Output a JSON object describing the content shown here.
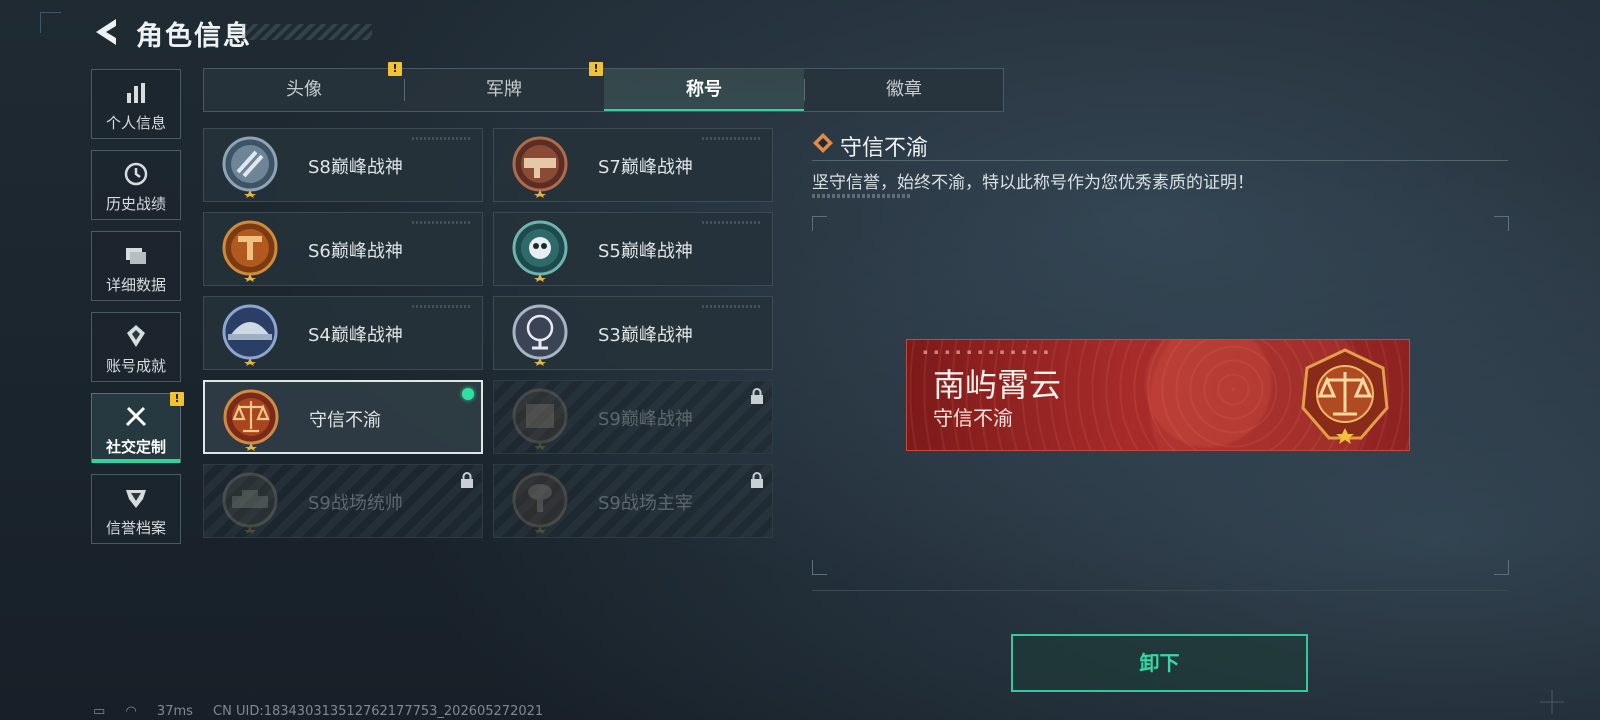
{
  "header": {
    "title": "角色信息"
  },
  "sidebar": {
    "items": [
      {
        "label": "个人信息",
        "icon": "bar-chart-icon"
      },
      {
        "label": "历史战绩",
        "icon": "clock-icon"
      },
      {
        "label": "详细数据",
        "icon": "folder-icon"
      },
      {
        "label": "账号成就",
        "icon": "achievement-icon"
      },
      {
        "label": "社交定制",
        "icon": "tools-icon",
        "active": true,
        "badge": "!"
      },
      {
        "label": "信誉档案",
        "icon": "credit-icon"
      }
    ]
  },
  "tabs": [
    {
      "label": "头像",
      "badge": "!"
    },
    {
      "label": "军牌",
      "badge": "!"
    },
    {
      "label": "称号",
      "active": true
    },
    {
      "label": "徽章"
    }
  ],
  "titles": [
    {
      "name": "S8巅峰战神",
      "icon": "s8-medal-icon"
    },
    {
      "name": "S7巅峰战神",
      "icon": "s7-medal-icon"
    },
    {
      "name": "S6巅峰战神",
      "icon": "s6-medal-icon"
    },
    {
      "name": "S5巅峰战神",
      "icon": "s5-medal-icon"
    },
    {
      "name": "S4巅峰战神",
      "icon": "s4-medal-icon"
    },
    {
      "name": "S3巅峰战神",
      "icon": "s3-medal-icon"
    },
    {
      "name": "守信不渝",
      "icon": "scales-medal-icon",
      "selected": true,
      "equipped": true
    },
    {
      "name": "S9巅峰战神",
      "icon": "s9-medal-icon",
      "locked": true
    },
    {
      "name": "S9战场统帅",
      "icon": "s9-commander-icon",
      "locked": true
    },
    {
      "name": "S9战场主宰",
      "icon": "s9-dominator-icon",
      "locked": true
    }
  ],
  "detail": {
    "title": "守信不渝",
    "description": "坚守信誉，始终不渝，特以此称号作为您优秀素质的证明！",
    "banner": {
      "player_name": "南屿霄云",
      "title": "守信不渝"
    },
    "button_label": "卸下"
  },
  "footer": {
    "ping": "37ms",
    "uid": "CN UID:183430313512762177753_202605272021"
  },
  "colors": {
    "accent": "#35c89a",
    "badge": "#f1c232",
    "banner": "#a72c2a"
  }
}
